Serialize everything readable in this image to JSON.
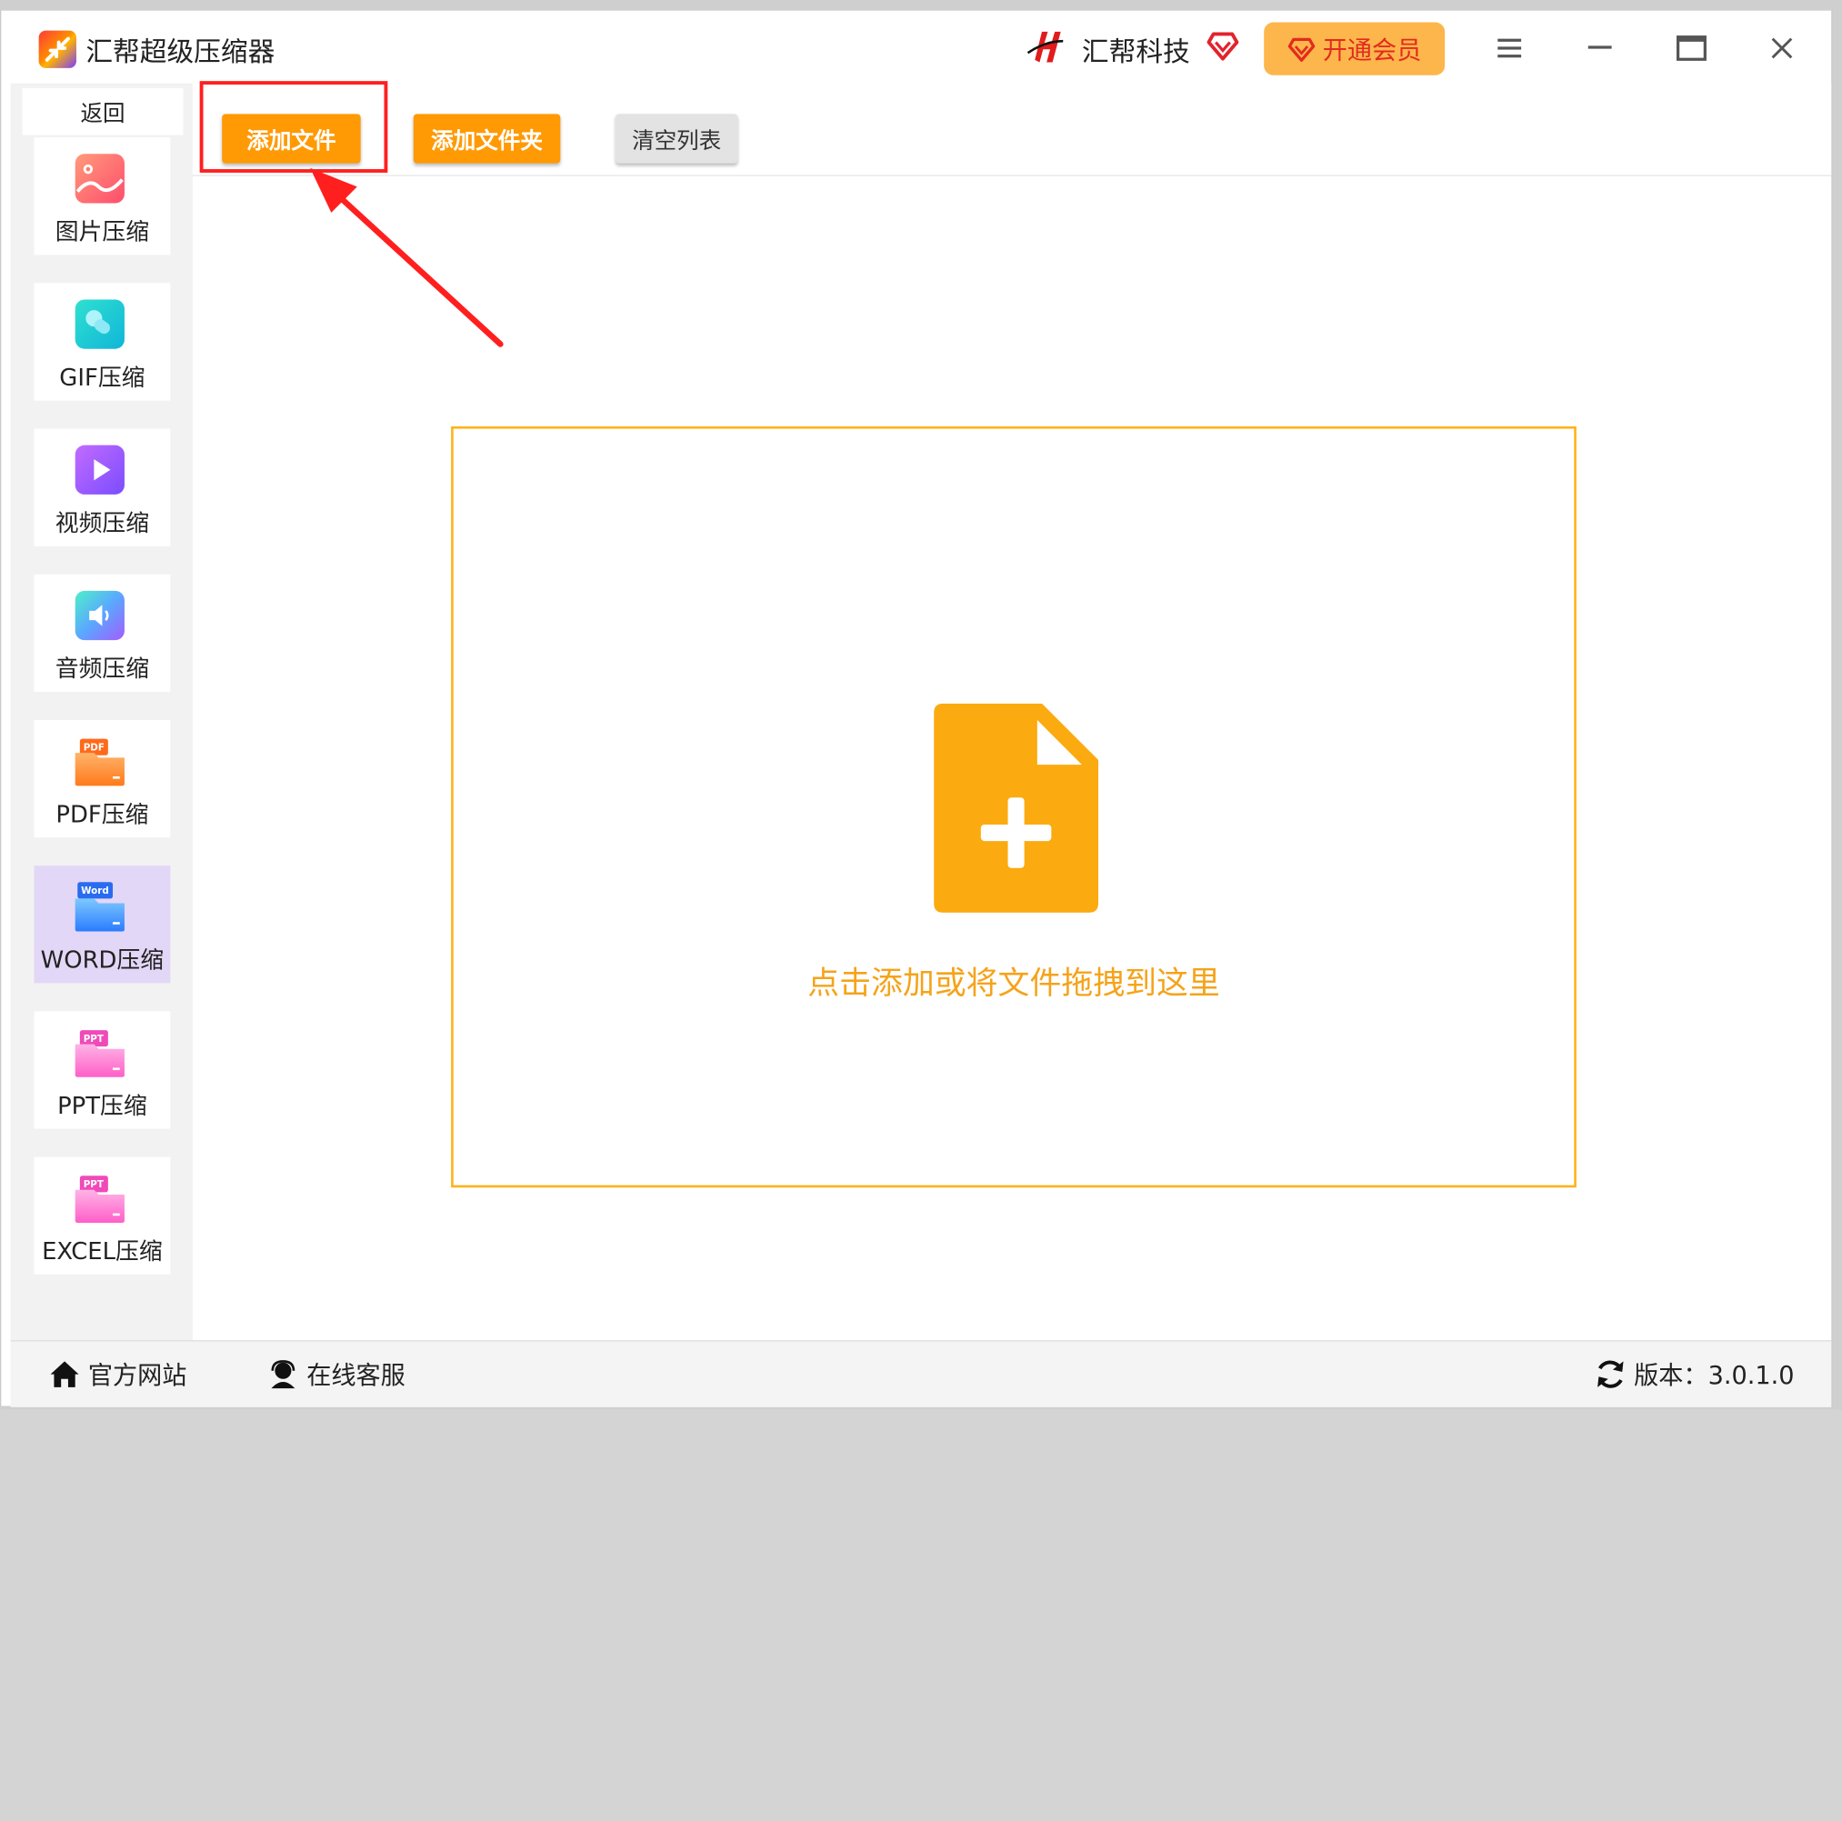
{
  "titlebar": {
    "app_title": "汇帮超级压缩器",
    "brand_name": "汇帮科技",
    "vip_label": "开通会员",
    "icons": [
      "app-logo-icon",
      "brand-logo-icon",
      "diamond-icon",
      "menu-icon",
      "minimize-icon",
      "maximize-icon",
      "close-icon"
    ]
  },
  "sidebar": {
    "back_label": "返回",
    "items": [
      {
        "label": "图片压缩",
        "icon": "image-icon"
      },
      {
        "label": "GIF压缩",
        "icon": "gif-icon"
      },
      {
        "label": "视频压缩",
        "icon": "video-icon"
      },
      {
        "label": "音频压缩",
        "icon": "audio-icon"
      },
      {
        "label": "PDF压缩",
        "icon": "pdf-folder-icon"
      },
      {
        "label": "WORD压缩",
        "icon": "word-folder-icon",
        "active": true
      },
      {
        "label": "PPT压缩",
        "icon": "ppt-folder-icon"
      },
      {
        "label": "EXCEL压缩",
        "icon": "excel-folder-icon"
      }
    ]
  },
  "toolbar": {
    "add_file": "添加文件",
    "add_folder": "添加文件夹",
    "clear_list": "清空列表"
  },
  "dropzone": {
    "hint": "点击添加或将文件拖拽到这里",
    "icon": "file-add-icon"
  },
  "footer": {
    "website": "官方网站",
    "support": "在线客服",
    "version": "版本：3.0.1.0"
  },
  "colors": {
    "accent_orange": "#ff9a05",
    "dropzone_border": "#ffb21a",
    "vip_bg": "#fdb64b",
    "annotation_red": "#ff1f1f",
    "active_nav": "#e3d7f7"
  }
}
